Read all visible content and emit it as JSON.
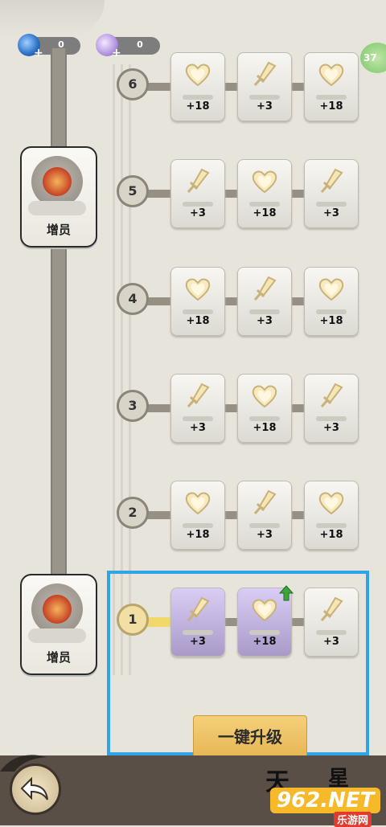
{
  "resources": [
    {
      "name": "blue-gem",
      "value": "0"
    },
    {
      "name": "purple-gem",
      "value": "0"
    }
  ],
  "side_badge": "37",
  "unlocks": [
    {
      "label": "增员"
    },
    {
      "label": "增员"
    }
  ],
  "levels": [
    {
      "level": "6",
      "cards": [
        {
          "icon": "heart",
          "value": "+18"
        },
        {
          "icon": "sword",
          "value": "+3"
        },
        {
          "icon": "heart",
          "value": "+18"
        }
      ]
    },
    {
      "level": "5",
      "cards": [
        {
          "icon": "sword",
          "value": "+3"
        },
        {
          "icon": "heart",
          "value": "+18"
        },
        {
          "icon": "sword",
          "value": "+3"
        }
      ]
    },
    {
      "level": "4",
      "cards": [
        {
          "icon": "heart",
          "value": "+18"
        },
        {
          "icon": "sword",
          "value": "+3"
        },
        {
          "icon": "heart",
          "value": "+18"
        }
      ]
    },
    {
      "level": "3",
      "cards": [
        {
          "icon": "sword",
          "value": "+3"
        },
        {
          "icon": "heart",
          "value": "+18"
        },
        {
          "icon": "sword",
          "value": "+3"
        }
      ]
    },
    {
      "level": "2",
      "cards": [
        {
          "icon": "heart",
          "value": "+18"
        },
        {
          "icon": "sword",
          "value": "+3"
        },
        {
          "icon": "heart",
          "value": "+18"
        }
      ]
    },
    {
      "level": "1",
      "cards": [
        {
          "icon": "sword",
          "value": "+3"
        },
        {
          "icon": "heart",
          "value": "+18"
        },
        {
          "icon": "sword",
          "value": "+3"
        }
      ]
    }
  ],
  "upgrade_button": "一键升级",
  "brand": {
    "char1": "天",
    "char2": "星",
    "logo": "962",
    "logo_suffix": ".NET",
    "sub": "乐游网"
  }
}
